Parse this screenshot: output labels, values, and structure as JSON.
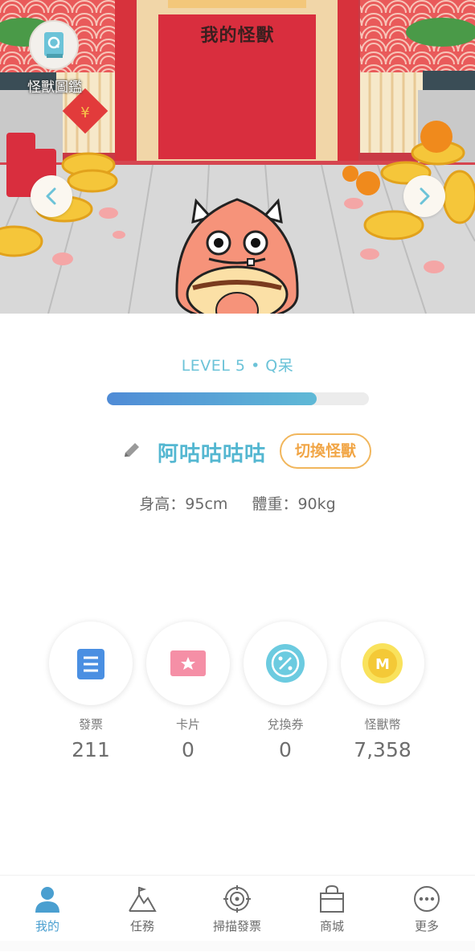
{
  "app": {
    "title": "我的怪獸"
  },
  "header": {
    "book_label": "怪獸圖鑑"
  },
  "monster": {
    "level_text": "LEVEL 5 • Q呆",
    "progress_fraction": 0.8,
    "name": "阿咕咕咕咕",
    "switch_label": "切換怪獸",
    "height_text": "身高：95cm",
    "weight_text": "體重：90kg"
  },
  "summary": [
    {
      "label": "發票",
      "value": "211",
      "icon": "invoice-icon"
    },
    {
      "label": "卡片",
      "value": "0",
      "icon": "card-icon"
    },
    {
      "label": "兌換券",
      "value": "0",
      "icon": "coupon-icon"
    },
    {
      "label": "怪獸幣",
      "value": "7,358",
      "icon": "monster-coin-icon"
    }
  ],
  "bottom_nav": [
    {
      "label": "我的",
      "icon": "person-icon",
      "active": true
    },
    {
      "label": "任務",
      "icon": "mountain-icon",
      "active": false
    },
    {
      "label": "掃描發票",
      "icon": "scan-target-icon",
      "active": false
    },
    {
      "label": "商城",
      "icon": "shopping-bag-icon",
      "active": false
    },
    {
      "label": "更多",
      "icon": "more-icon",
      "active": false
    }
  ],
  "colors": {
    "accent": "#54b7d1",
    "active_nav": "#4a9fd0",
    "switch_orange": "#f1a545",
    "progress_start": "#4f8bd6",
    "progress_end": "#5fb9d6"
  }
}
